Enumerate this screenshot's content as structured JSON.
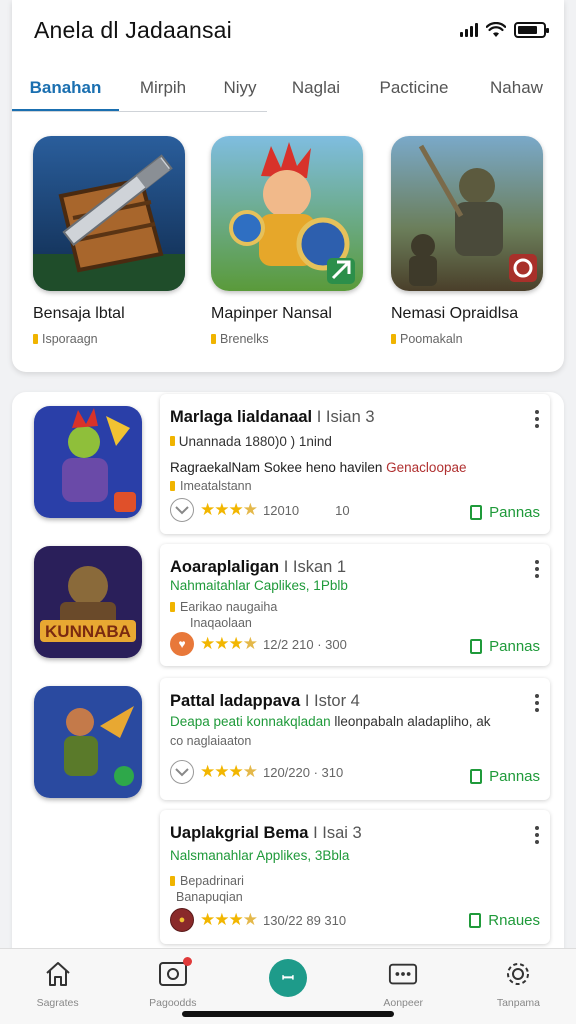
{
  "status_bar": {
    "title": "Anela dl Jadaansai"
  },
  "tabs": [
    {
      "label": "Banahan",
      "active": true
    },
    {
      "label": "Mirpih"
    },
    {
      "label": "Niyy"
    },
    {
      "label": "Naglai"
    },
    {
      "label": "Pacticine"
    },
    {
      "label": "Nahaw"
    }
  ],
  "featured": [
    {
      "name": "Bensaja lbtal",
      "sub": "Isporaagn",
      "icon": "crate-sword-art"
    },
    {
      "name": "Mapinper Nansal",
      "sub": "Brenelks",
      "icon": "hero-shield-art"
    },
    {
      "name": "Nemasi Opraidlsa",
      "sub": "Poomakaln",
      "icon": "warrior-army-art"
    }
  ],
  "list": [
    {
      "title": "Marlaga lialdanaal",
      "title_suffix": "Isian 3",
      "line2": "Unannada 1880)0 ) 1nind",
      "line3_main": "RagraekalNam Sokee heno havilen",
      "line3_red": "Genacloopae",
      "line4": "Imeatalstann",
      "rating_count": "12010",
      "rating_extra": "10",
      "action": "Pannas",
      "icon": "armored-hero-art"
    },
    {
      "title": "Aoaraplaligan",
      "title_suffix": "Iskan 1",
      "line2": "Nahmaitahlar Caplikes, 1Pblb",
      "line3_main": "Earikao naugaiha",
      "line4": "Inaqaolaan",
      "rating_count": "12/2 210 · 300",
      "action": "Pannas",
      "icon": "kunnaba-title-art"
    },
    {
      "title": "Pattal ladappava",
      "title_suffix": "Istor 4",
      "line2": "Deapa peati konnakqladan",
      "line2_dark": "lleonpabaln aladapliho, ak",
      "line3_main": "co naglaiaaton",
      "rating_count": "120/220 · 310",
      "action": "Pannas",
      "icon": "ranger-battle-art"
    },
    {
      "title": "Uaplakgrial Bema",
      "title_suffix": "Isai 3",
      "line2": "Nalsmanahlar Applikes, 3Bbla",
      "line3_main": "Bepadrinari",
      "line4": "Banapuqian",
      "rating_count": "130/22 89 310",
      "action": "Rnaues",
      "icon": "avatar-badge"
    }
  ],
  "bottom_nav": [
    {
      "label": "Sagrates",
      "icon": "home-icon"
    },
    {
      "label": "Pagoodds",
      "icon": "library-icon",
      "badge": true
    },
    {
      "label": "",
      "icon": "center-action-icon",
      "center_glyph": "ꟷ"
    },
    {
      "label": "Aonpeer",
      "icon": "chat-icon"
    },
    {
      "label": "Tanpama",
      "icon": "gear-icon"
    }
  ],
  "colors": {
    "accent": "#1a6fb0",
    "green": "#1f9a3a",
    "star": "#f2b600",
    "teal": "#1e9b8a"
  }
}
